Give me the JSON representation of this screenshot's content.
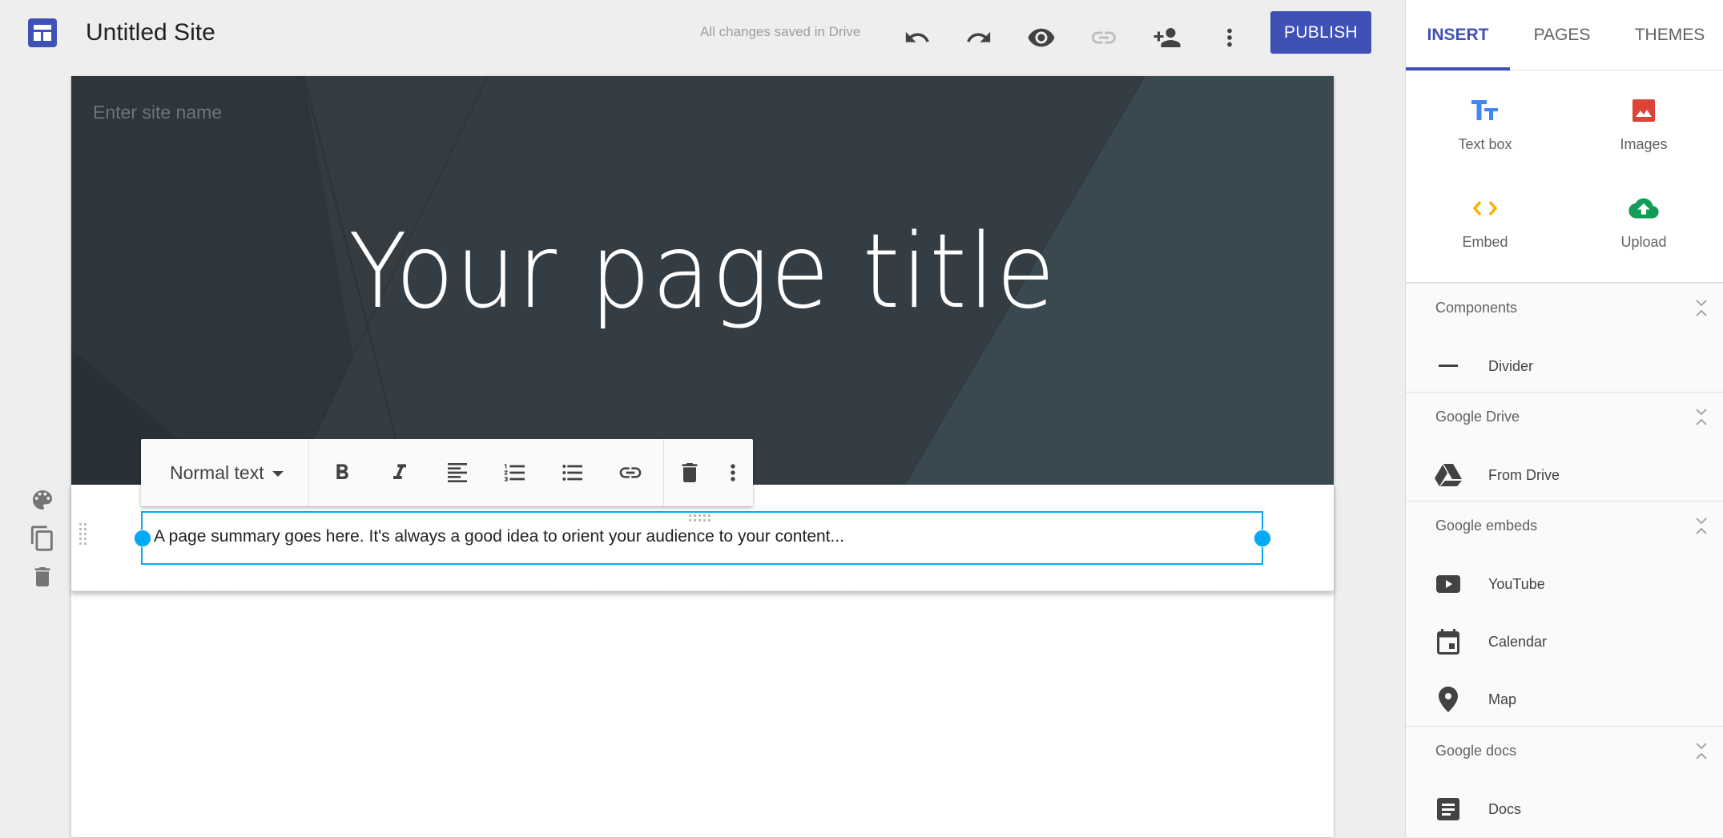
{
  "app": {
    "logo_icon": "google-sites-logo-icon",
    "site_title": "Untitled Site",
    "save_status": "All changes saved in Drive",
    "toolbar": {
      "undo_icon": "undo-icon",
      "redo_icon": "redo-icon",
      "preview_icon": "eye-icon",
      "link_icon": "link-icon",
      "share_icon": "person-add-icon",
      "more_icon": "more-vert-icon",
      "publish_label": "PUBLISH"
    }
  },
  "canvas": {
    "site_name_placeholder": "Enter site name",
    "page_title": "Your page title",
    "summary_text": "A page summary goes here. It's always a good idea to orient your audience to your content...",
    "text_toolbar": {
      "style_label": "Normal text",
      "buttons": [
        "bold",
        "italic",
        "align-left",
        "numbered-list",
        "bulleted-list",
        "link",
        "delete",
        "more"
      ]
    },
    "section_tools": [
      "palette",
      "duplicate",
      "delete"
    ]
  },
  "panel": {
    "tabs": [
      {
        "label": "INSERT",
        "active": true
      },
      {
        "label": "PAGES",
        "active": false
      },
      {
        "label": "THEMES",
        "active": false
      }
    ],
    "insert_items": [
      {
        "label": "Text box",
        "icon": "text-box-icon",
        "color": "#4285f4"
      },
      {
        "label": "Images",
        "icon": "image-icon",
        "color": "#db4437"
      },
      {
        "label": "Embed",
        "icon": "embed-code-icon",
        "color": "#f4b400"
      },
      {
        "label": "Upload",
        "icon": "cloud-upload-icon",
        "color": "#0f9d58"
      }
    ],
    "sections": [
      {
        "title": "Components",
        "items": [
          {
            "label": "Divider",
            "icon": "divider-icon"
          }
        ]
      },
      {
        "title": "Google Drive",
        "items": [
          {
            "label": "From Drive",
            "icon": "drive-icon"
          }
        ]
      },
      {
        "title": "Google embeds",
        "items": [
          {
            "label": "YouTube",
            "icon": "youtube-icon"
          },
          {
            "label": "Calendar",
            "icon": "calendar-icon"
          },
          {
            "label": "Map",
            "icon": "map-pin-icon"
          }
        ]
      },
      {
        "title": "Google docs",
        "items": [
          {
            "label": "Docs",
            "icon": "docs-icon"
          }
        ]
      }
    ]
  },
  "colors": {
    "accent": "#3f51b5",
    "selection": "#03a9f4",
    "banner": "#2e353b"
  }
}
